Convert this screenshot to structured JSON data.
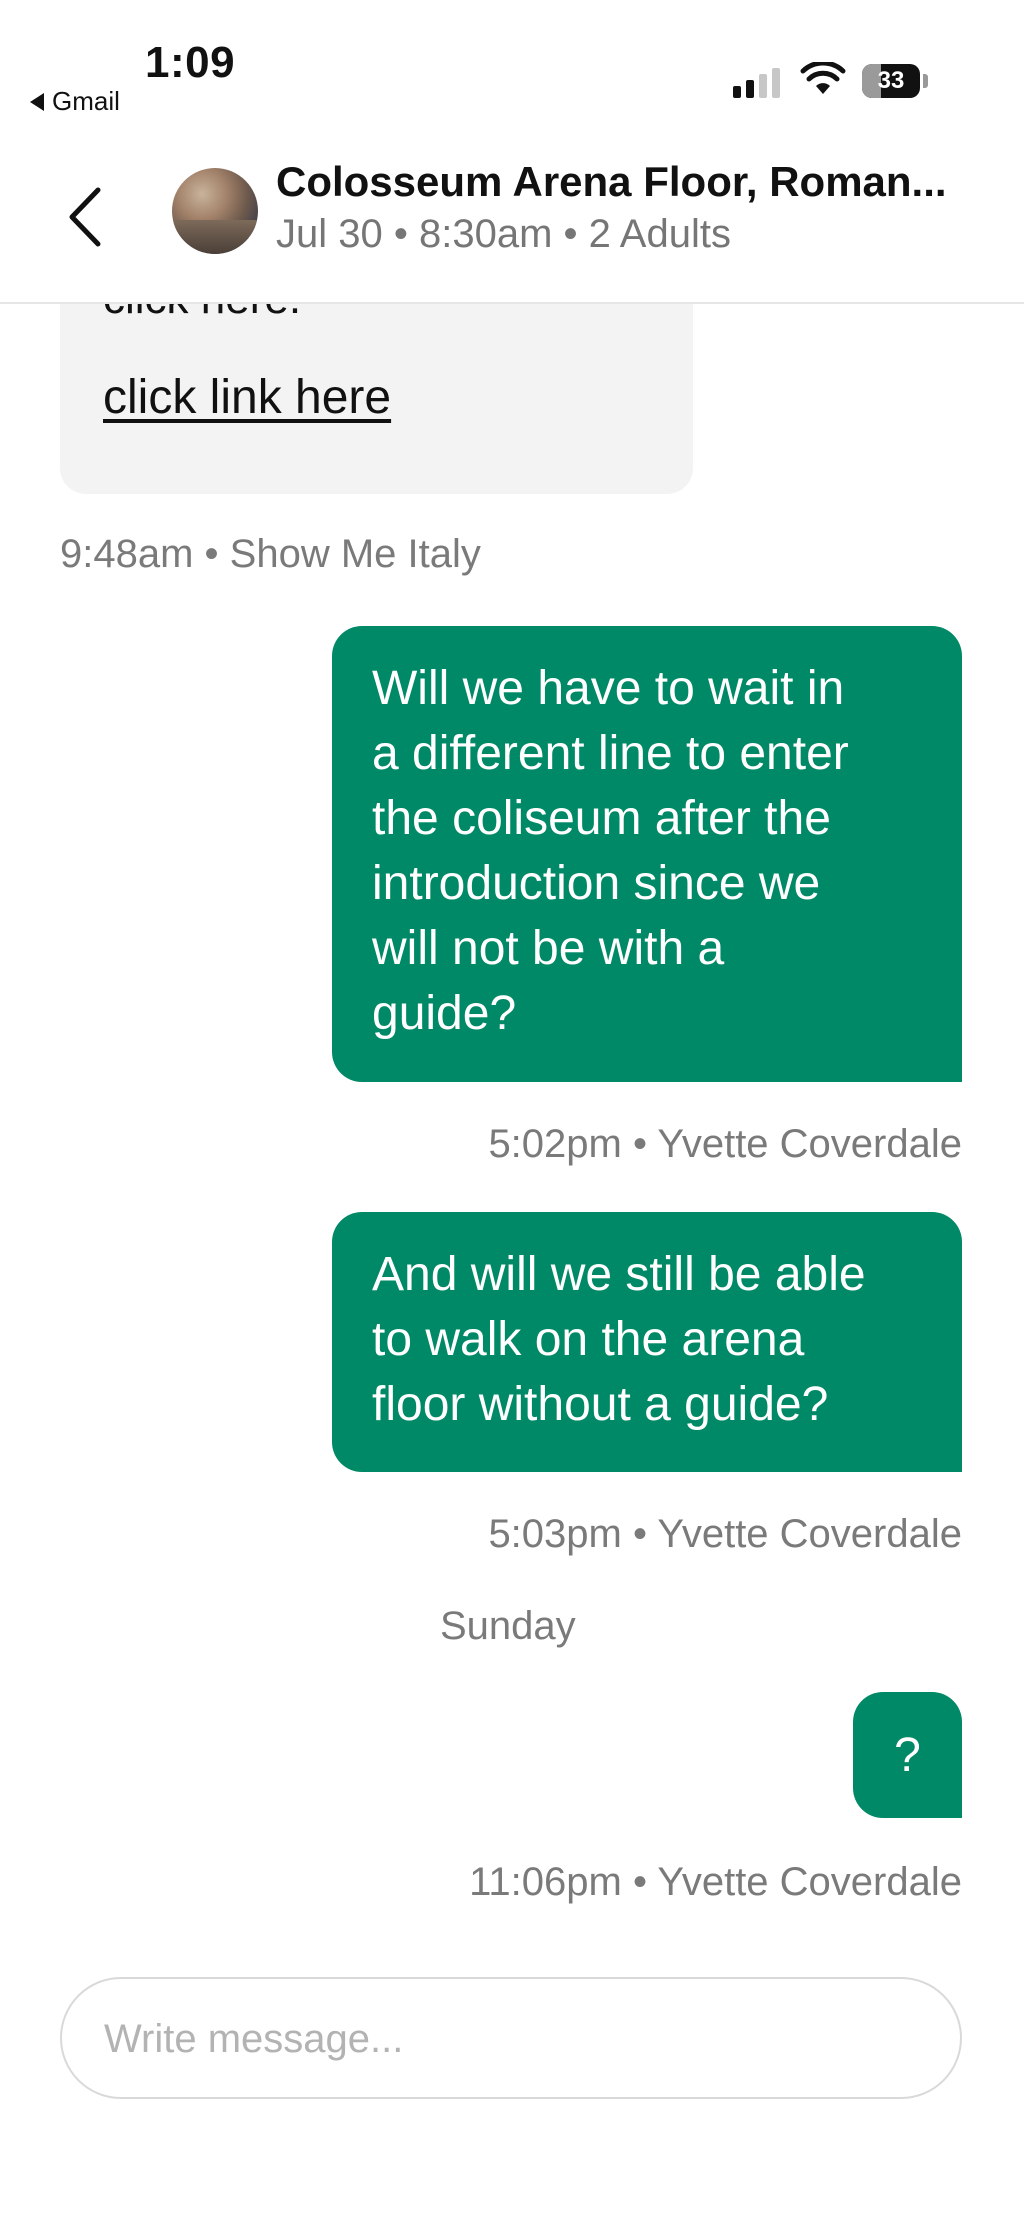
{
  "status_bar": {
    "time": "1:09",
    "back_app": "Gmail",
    "battery": "33",
    "battery_level": 0.33,
    "signal_bars_active": 2,
    "signal_bars_total": 4
  },
  "header": {
    "title": "Colosseum Arena Floor, Roman...",
    "subtitle": "Jul 30 • 8:30am • 2 Adults"
  },
  "messages": {
    "incoming": {
      "cut_text": "click here.",
      "link_text": "click link here",
      "meta": "9:48am • Show Me Italy"
    },
    "out1": {
      "lines": [
        "Will we have to wait in",
        "a different line to enter",
        "the coliseum after the",
        "introduction since we",
        "will not be with a",
        "guide?"
      ],
      "meta": "5:02pm • Yvette Coverdale"
    },
    "out2": {
      "lines": [
        "And will we still be able",
        "to walk on the arena",
        "floor without a guide?"
      ],
      "meta": "5:03pm • Yvette Coverdale"
    },
    "day_separator": "Sunday",
    "out3": {
      "text": "?",
      "meta": "11:06pm • Yvette Coverdale"
    }
  },
  "composer": {
    "placeholder": "Write message..."
  },
  "colors": {
    "bubble": "#008966",
    "incoming_bubble": "#f3f3f3",
    "meta_text": "#7a7a7a"
  }
}
